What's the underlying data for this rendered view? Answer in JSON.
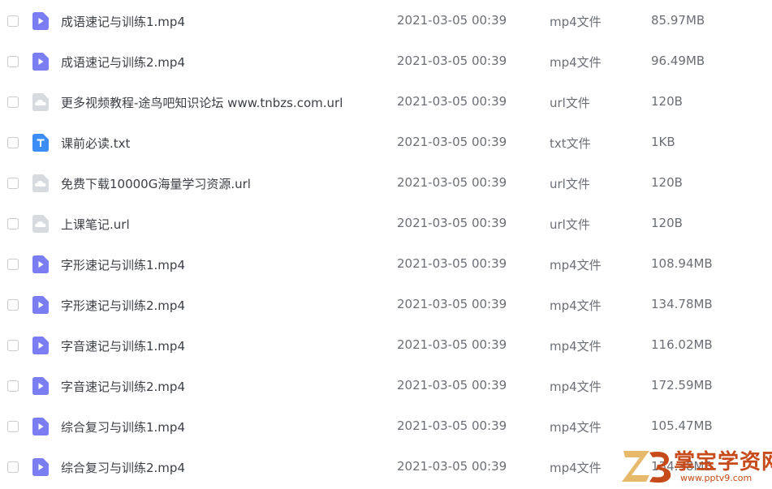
{
  "files": [
    {
      "name": "成语速记与训练1.mp4",
      "date": "2021-03-05 00:39",
      "type": "mp4文件",
      "size": "85.97MB",
      "icon": "video"
    },
    {
      "name": "成语速记与训练2.mp4",
      "date": "2021-03-05 00:39",
      "type": "mp4文件",
      "size": "96.49MB",
      "icon": "video"
    },
    {
      "name": "更多视频教程-途鸟吧知识论坛 www.tnbzs.com.url",
      "date": "2021-03-05 00:39",
      "type": "url文件",
      "size": "120B",
      "icon": "url"
    },
    {
      "name": "课前必读.txt",
      "date": "2021-03-05 00:39",
      "type": "txt文件",
      "size": "1KB",
      "icon": "txt"
    },
    {
      "name": "免费下载10000G海量学习资源.url",
      "date": "2021-03-05 00:39",
      "type": "url文件",
      "size": "120B",
      "icon": "url"
    },
    {
      "name": "上课笔记.url",
      "date": "2021-03-05 00:39",
      "type": "url文件",
      "size": "120B",
      "icon": "url"
    },
    {
      "name": "字形速记与训练1.mp4",
      "date": "2021-03-05 00:39",
      "type": "mp4文件",
      "size": "108.94MB",
      "icon": "video"
    },
    {
      "name": "字形速记与训练2.mp4",
      "date": "2021-03-05 00:39",
      "type": "mp4文件",
      "size": "134.78MB",
      "icon": "video"
    },
    {
      "name": "字音速记与训练1.mp4",
      "date": "2021-03-05 00:39",
      "type": "mp4文件",
      "size": "116.02MB",
      "icon": "video"
    },
    {
      "name": "字音速记与训练2.mp4",
      "date": "2021-03-05 00:39",
      "type": "mp4文件",
      "size": "172.59MB",
      "icon": "video"
    },
    {
      "name": "综合复习与训练1.mp4",
      "date": "2021-03-05 00:39",
      "type": "mp4文件",
      "size": "105.47MB",
      "icon": "video"
    },
    {
      "name": "综合复习与训练2.mp4",
      "date": "2021-03-05 00:39",
      "type": "mp4文件",
      "size": "134.38MB",
      "icon": "video"
    }
  ],
  "watermark": {
    "logo_text": "Z3",
    "title": "掌宝学资网",
    "url": "www.pptv9.com"
  },
  "colors": {
    "video_icon": "#7b7ef2",
    "txt_icon": "#3c8ef6",
    "url_icon": "#d7dbe0",
    "watermark": "#c64a1a"
  }
}
